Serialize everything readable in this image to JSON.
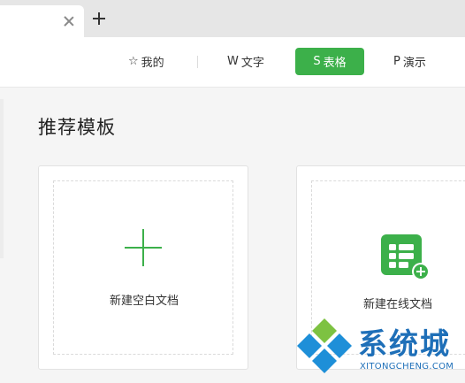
{
  "toolbar": {
    "mine_label": "我的",
    "word_label": "文字",
    "sheet_label": "表格",
    "ppt_label": "演示",
    "mine_icon": "star-icon",
    "word_icon": "w-icon",
    "sheet_icon": "s-icon",
    "ppt_icon": "p-icon",
    "active": "sheet",
    "accent": "#3cb04a"
  },
  "section": {
    "title": "推荐模板"
  },
  "cards": {
    "blank": {
      "label": "新建空白文档",
      "icon": "plus-icon"
    },
    "online": {
      "label": "新建在线文档",
      "icon": "online-sheet-icon"
    }
  },
  "watermark": {
    "text": "系统城",
    "url": "XITONGCHENG.COM",
    "color": "#1e6fb8"
  }
}
